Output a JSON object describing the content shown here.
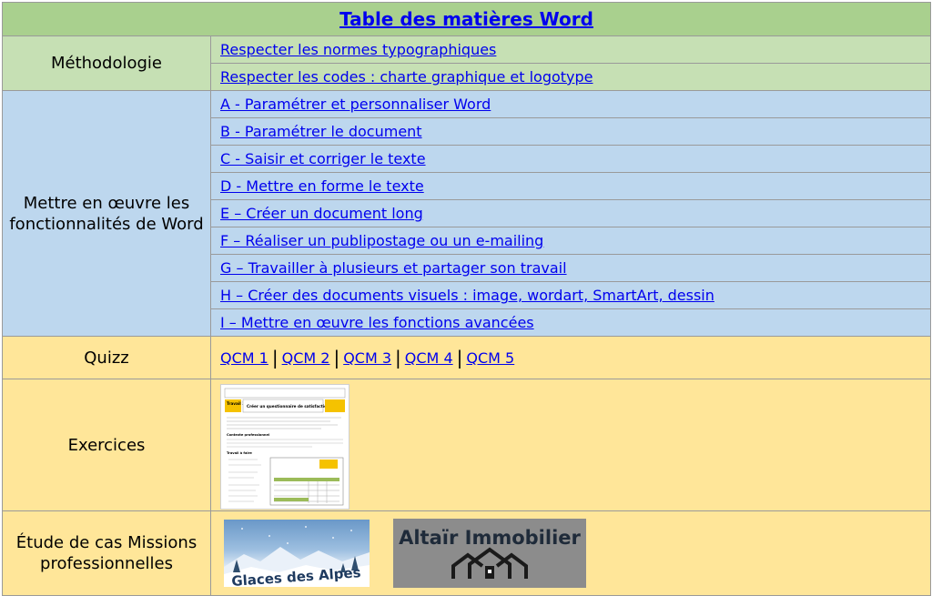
{
  "title": "Table des matières Word",
  "sections": {
    "methodologie": {
      "label": "Méthodologie",
      "links": [
        "Respecter les normes typographiques",
        "Respecter les codes : charte graphique et logotype"
      ]
    },
    "fonctionnalites": {
      "label": "Mettre en œuvre les fonctionnalités de Word",
      "links": [
        "A - Paramétrer et personnaliser Word",
        "B - Paramétrer le document",
        "C - Saisir et corriger le texte",
        "D - Mettre en forme le texte",
        "E – Créer un document long",
        "F – Réaliser un publipostage ou un e-mailing",
        "G – Travailler à plusieurs et partager son travail",
        "H – Créer des documents visuels : image, wordart, SmartArt, dessin",
        "I – Mettre en œuvre les fonctions avancées"
      ]
    },
    "quizz": {
      "label": "Quizz",
      "links": [
        "QCM 1",
        "QCM 2",
        "QCM 3",
        "QCM 4",
        "QCM 5"
      ],
      "separator": "|"
    },
    "exercices": {
      "label": "Exercices",
      "thumbnail_text": {
        "header": "Travail 3.2",
        "title": "Créer un questionnaire de satisfaction",
        "section": "Contexte professionnel",
        "list_title": "Travail à faire"
      }
    },
    "etude": {
      "label": "Étude de cas Missions professionnelles",
      "logos": {
        "glaces": "Glaces des Alpes",
        "altair": "Altaïr Immobilier"
      }
    }
  },
  "colors": {
    "header_bg": "#a9d08e",
    "green_bg": "#c6e0b4",
    "blue_bg": "#bdd7ee",
    "yellow_bg": "#ffe699",
    "link": "#0000ee"
  }
}
